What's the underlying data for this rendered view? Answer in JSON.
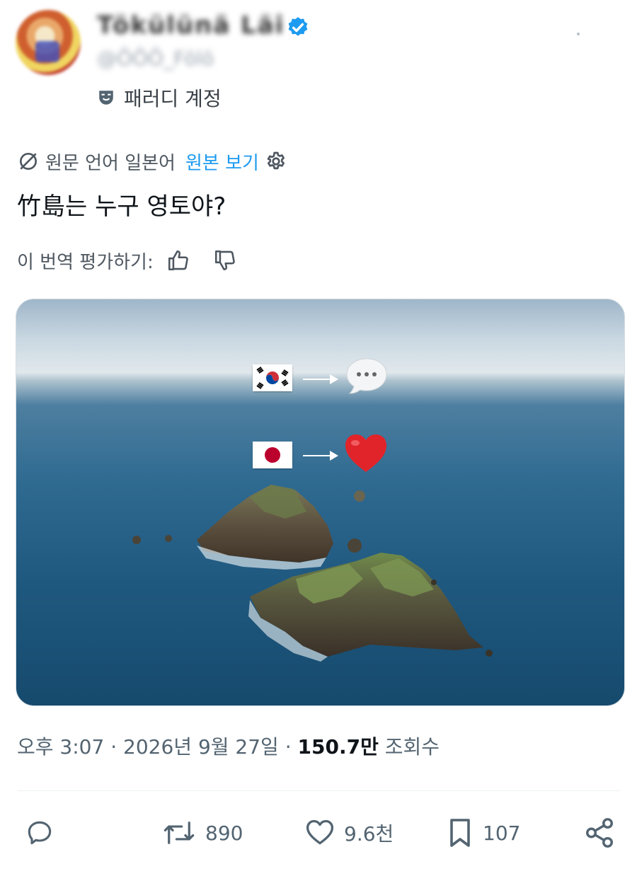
{
  "user": {
    "display_name": "Tökülünä Läi",
    "handle": "@ÖÖÖ_Fölö",
    "verified_icon": "verified-badge-icon",
    "parody_label": "패러디 계정"
  },
  "translation": {
    "source_language": "원문 언어 일본어",
    "show_original": "원본 보기",
    "rate_prompt": "이 번역 평가하기:"
  },
  "tweet": {
    "text": "竹島는 누구 영토야?"
  },
  "media": {
    "description_icons": [
      "korea-flag-icon",
      "speech-bubble-icon",
      "japan-flag-icon",
      "red-heart-icon"
    ]
  },
  "meta": {
    "time": "오후 3:07",
    "separator": "·",
    "date": "2026년 9월 27일",
    "views_count": "150.7만",
    "views_label": "조회수"
  },
  "actions": {
    "reply_count": "",
    "retweet_count": "890",
    "like_count": "9.6천",
    "bookmark_count": "107"
  },
  "colors": {
    "link": "#1d9bf0",
    "verified": "#1d9bf0",
    "heart": "#e0242a"
  }
}
